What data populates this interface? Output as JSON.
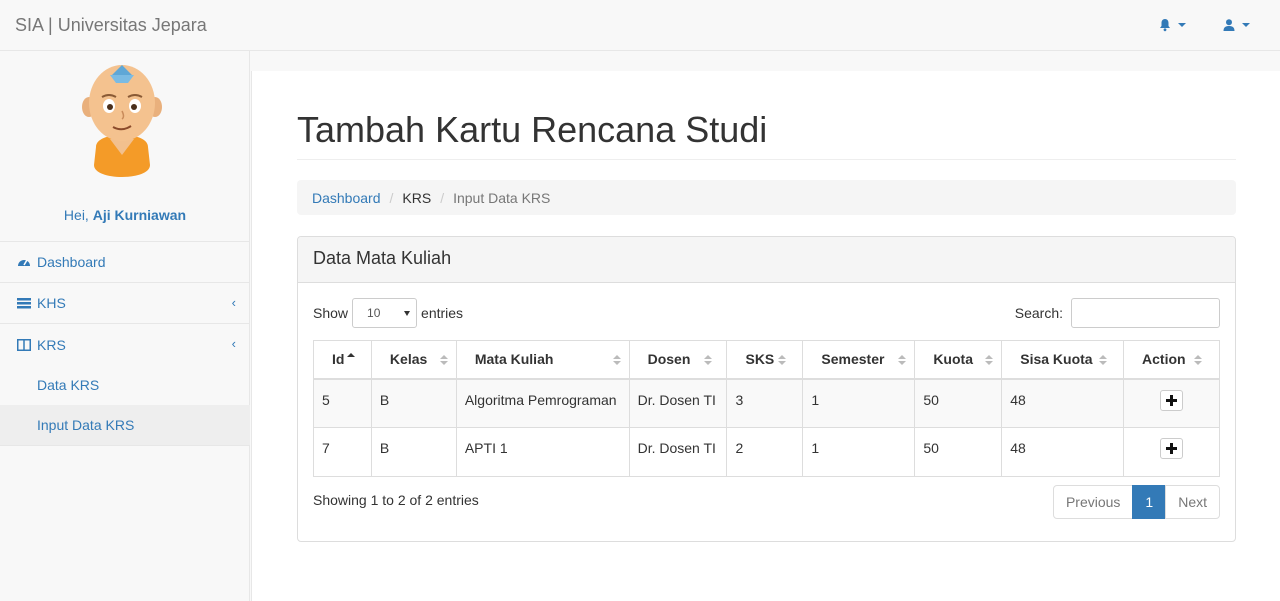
{
  "navbar": {
    "brand": "SIA | Universitas Jepara",
    "accent": "#337ab7"
  },
  "sidebar": {
    "greeting": "Hei,",
    "user_name": "Aji Kurniawan",
    "items": [
      {
        "label": "Dashboard",
        "icon": "dashboard-icon"
      },
      {
        "label": "KHS",
        "icon": "list-icon"
      },
      {
        "label": "KRS",
        "icon": "columns-icon"
      }
    ],
    "sub_items": [
      {
        "label": "Data KRS"
      },
      {
        "label": "Input Data KRS"
      }
    ]
  },
  "page": {
    "title": "Tambah Kartu Rencana Studi",
    "breadcrumb": [
      "Dashboard",
      "KRS",
      "Input Data KRS"
    ]
  },
  "panel": {
    "heading": "Data Mata Kuliah",
    "show_label": "Show",
    "entries_value": "10",
    "entries_label": "entries",
    "search_label": "Search:",
    "search_value": "",
    "columns": [
      "Id",
      "Kelas",
      "Mata Kuliah",
      "Dosen",
      "SKS",
      "Semester",
      "Kuota",
      "Sisa Kuota",
      "Action"
    ],
    "rows": [
      [
        "5",
        "B",
        "Algoritma Pemrograman",
        "Dr. Dosen TI",
        "3",
        "1",
        "50",
        "48"
      ],
      [
        "7",
        "B",
        "APTI 1",
        "Dr. Dosen TI",
        "2",
        "1",
        "50",
        "48"
      ]
    ],
    "info": "Showing 1 to 2 of 2 entries",
    "pagination": {
      "previous": "Previous",
      "current": "1",
      "next": "Next"
    }
  }
}
